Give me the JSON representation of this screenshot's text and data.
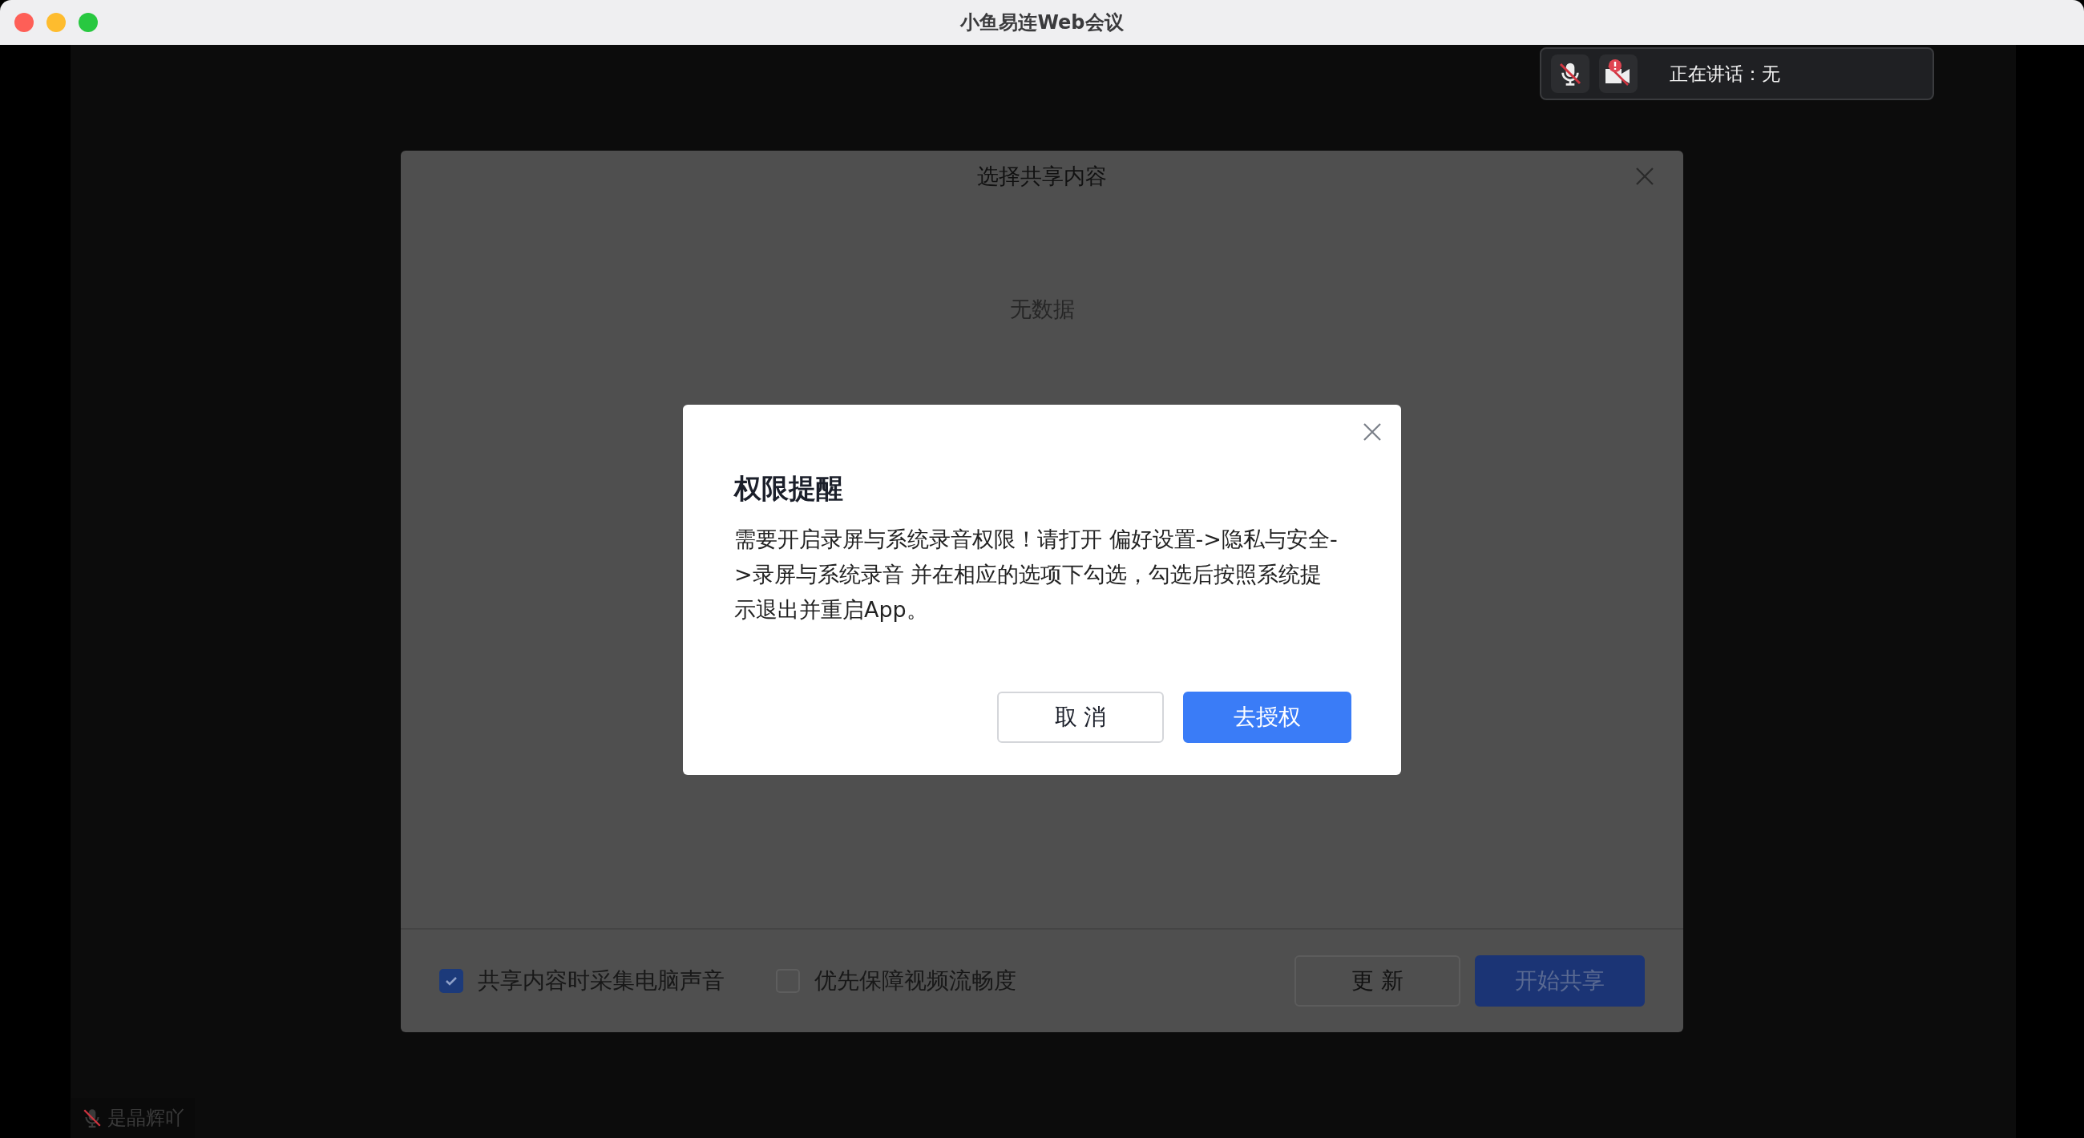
{
  "window": {
    "title": "小鱼易连Web会议"
  },
  "speaking_panel": {
    "mic_muted": true,
    "camera_muted": true,
    "label": "正在讲话：无"
  },
  "share_dialog": {
    "title": "选择共享内容",
    "empty_text": "无数据",
    "options": [
      {
        "label": "共享内容时采集电脑声音",
        "checked": true
      },
      {
        "label": "优先保障视频流畅度",
        "checked": false
      }
    ],
    "buttons": [
      {
        "label": "更 新",
        "kind": "secondary"
      },
      {
        "label": "开始共享",
        "kind": "primary"
      }
    ]
  },
  "alert": {
    "title": "权限提醒",
    "message": "需要开启录屏与系统录音权限！请打开 偏好设置->隐私与安全->录屏与系统录音 并在相应的选项下勾选，勾选后按照系统提示退出并重启App。",
    "buttons": [
      {
        "label": "取 消",
        "kind": "secondary"
      },
      {
        "label": "去授权",
        "kind": "primary"
      }
    ]
  },
  "participant": {
    "name": "是晶辉吖",
    "muted": true
  }
}
